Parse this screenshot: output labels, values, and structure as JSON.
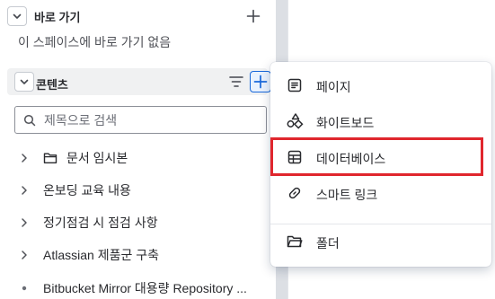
{
  "sidebar": {
    "shortcuts": {
      "title": "바로 가기",
      "empty_message": "이 스페이스에 바로 가기 없음"
    },
    "content": {
      "title": "콘텐츠"
    },
    "search": {
      "placeholder": "제목으로 검색"
    },
    "tree": [
      {
        "label": "문서 임시본",
        "kind": "folder",
        "expandable": true
      },
      {
        "label": "온보딩 교육 내용",
        "kind": "page",
        "expandable": true
      },
      {
        "label": "정기점검 시 점검 사항",
        "kind": "page",
        "expandable": true
      },
      {
        "label": "Atlassian 제품군 구축",
        "kind": "page",
        "expandable": true
      },
      {
        "label": "Bitbucket Mirror 대용량 Repository ...",
        "kind": "page",
        "expandable": false
      }
    ]
  },
  "menu": {
    "items": [
      {
        "label": "페이지",
        "icon": "page-icon"
      },
      {
        "label": "화이트보드",
        "icon": "whiteboard-icon"
      },
      {
        "label": "데이터베이스",
        "icon": "database-icon"
      },
      {
        "label": "스마트 링크",
        "icon": "smart-link-icon"
      },
      {
        "label": "폴더",
        "icon": "folder-icon"
      }
    ],
    "highlighted": "데이터베이스"
  },
  "colors": {
    "accent": "#1868db",
    "highlight": "#e0262d",
    "text": "#292a2e",
    "muted": "#505258"
  }
}
